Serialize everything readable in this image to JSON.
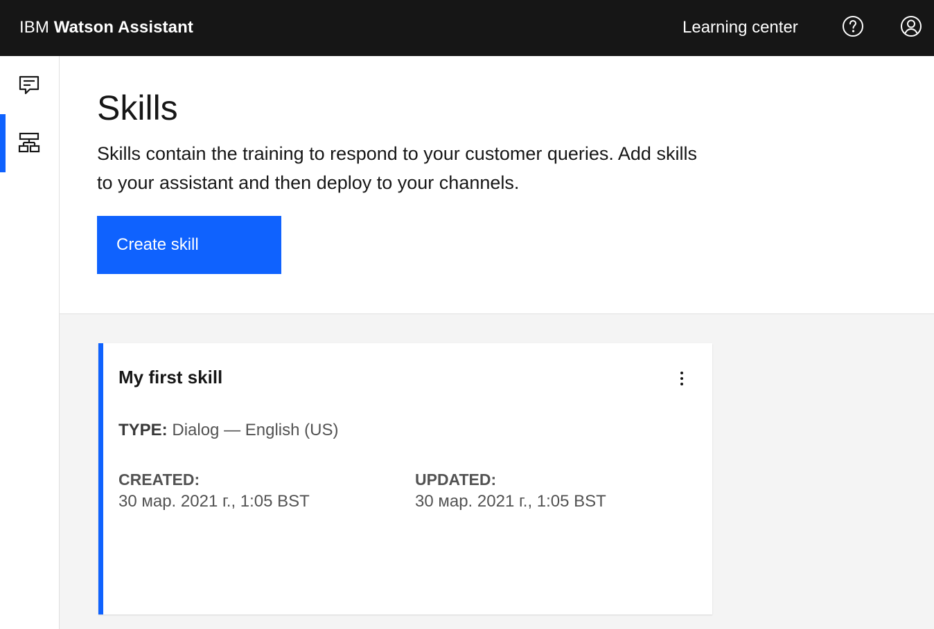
{
  "header": {
    "brand_light": "IBM",
    "brand_bold": "Watson Assistant",
    "learning_center": "Learning center",
    "help_icon": "help-icon",
    "user_icon": "user-avatar-icon",
    "background": "#161616"
  },
  "sidebar": {
    "items": [
      {
        "icon": "chat-icon",
        "active": false
      },
      {
        "icon": "skills-icon",
        "active": true
      }
    ],
    "active_color": "#0f62fe"
  },
  "page": {
    "title": "Skills",
    "description": "Skills contain the training to respond to your customer queries. Add skills to your assistant and then deploy to your channels.",
    "create_button": "Create skill"
  },
  "skill_card": {
    "title": "My first skill",
    "type_label": "TYPE:",
    "type_value": "Dialog — English (US)",
    "created_label": "CREATED:",
    "created_value": "30 мар. 2021 г., 1:05 BST",
    "updated_label": "UPDATED:",
    "updated_value": "30 мар. 2021 г., 1:05 BST",
    "menu_icon": "overflow-menu-icon"
  },
  "colors": {
    "accent": "#0f62fe",
    "content_bg": "#f4f4f4",
    "text": "#161616",
    "secondary_text": "#525252"
  }
}
